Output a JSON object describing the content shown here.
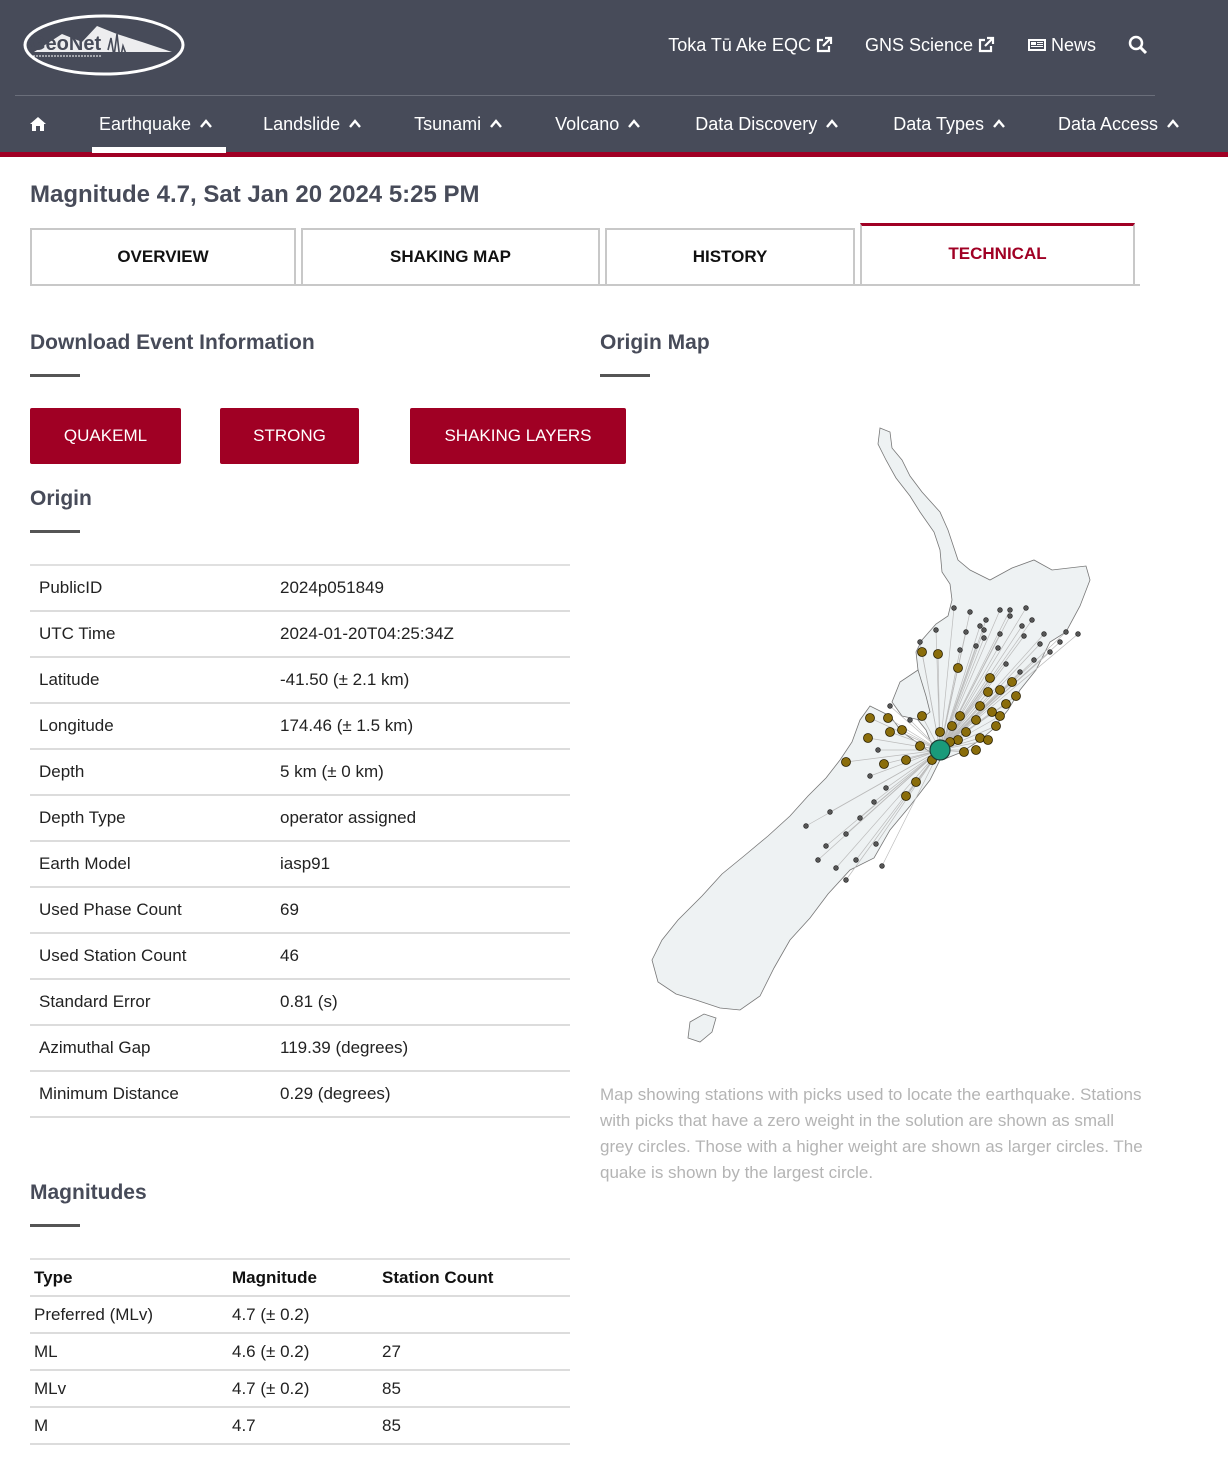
{
  "brand": {
    "name": "GeoNet"
  },
  "top_links": [
    {
      "label": "Toka Tū Ake EQC",
      "icon": "external-link-icon"
    },
    {
      "label": "GNS Science",
      "icon": "external-link-icon"
    },
    {
      "label": "News",
      "icon": "newspaper-icon"
    }
  ],
  "nav": {
    "items": [
      {
        "label": "Earthquake",
        "active": true
      },
      {
        "label": "Landslide"
      },
      {
        "label": "Tsunami"
      },
      {
        "label": "Volcano"
      },
      {
        "label": "Data Discovery"
      },
      {
        "label": "Data Types"
      },
      {
        "label": "Data Access"
      }
    ]
  },
  "page": {
    "title": "Magnitude 4.7, Sat Jan 20 2024 5:25 PM"
  },
  "tabs": [
    {
      "label": "OVERVIEW"
    },
    {
      "label": "SHAKING MAP"
    },
    {
      "label": "HISTORY"
    },
    {
      "label": "TECHNICAL",
      "active": true
    }
  ],
  "download": {
    "title": "Download Event Information",
    "buttons": [
      {
        "label": "QUAKEML"
      },
      {
        "label": "STRONG"
      },
      {
        "label": "SHAKING LAYERS"
      }
    ]
  },
  "origin": {
    "title": "Origin",
    "rows": [
      {
        "key": "PublicID",
        "value": "2024p051849"
      },
      {
        "key": "UTC Time",
        "value": "2024-01-20T04:25:34Z"
      },
      {
        "key": "Latitude",
        "value": "-41.50 (± 2.1 km)"
      },
      {
        "key": "Longitude",
        "value": "174.46 (± 1.5 km)"
      },
      {
        "key": "Depth",
        "value": "5 km (± 0 km)"
      },
      {
        "key": "Depth Type",
        "value": "operator assigned"
      },
      {
        "key": "Earth Model",
        "value": "iasp91"
      },
      {
        "key": "Used Phase Count",
        "value": "69"
      },
      {
        "key": "Used Station Count",
        "value": "46"
      },
      {
        "key": "Standard Error",
        "value": "0.81 (s)"
      },
      {
        "key": "Azimuthal Gap",
        "value": "119.39 (degrees)"
      },
      {
        "key": "Minimum Distance",
        "value": "0.29 (degrees)"
      }
    ]
  },
  "magnitudes": {
    "title": "Magnitudes",
    "headers": [
      "Type",
      "Magnitude",
      "Station Count"
    ],
    "rows": [
      {
        "type": "Preferred (MLv)",
        "magnitude": "4.7 (± 0.2)",
        "count": ""
      },
      {
        "type": "ML",
        "magnitude": "4.6 (± 0.2)",
        "count": "27"
      },
      {
        "type": "MLv",
        "magnitude": "4.7 (± 0.2)",
        "count": "85"
      },
      {
        "type": "M",
        "magnitude": "4.7",
        "count": "85"
      }
    ]
  },
  "origin_map": {
    "title": "Origin Map",
    "caption": "Map showing stations with picks used to locate the earthquake. Stations with picks that have a zero weight in the solution are shown as small grey circles. Those with a higher weight are shown as larger circles. The quake is shown by the largest circle."
  },
  "colors": {
    "header_bg": "#474b59",
    "accent": "#a00024",
    "weighted_station": "#8a6d0b",
    "zero_weight_station": "#555555",
    "quake": "#1a9a7a",
    "land": "#eef2f3"
  }
}
